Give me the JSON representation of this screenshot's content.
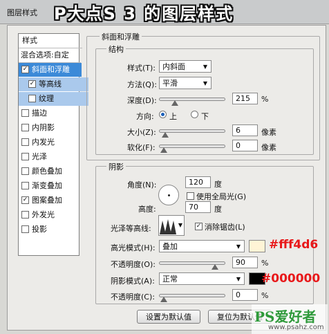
{
  "window": {
    "title": "图层样式",
    "banner": "P大点S 3 的图层样式"
  },
  "sidebar": {
    "header": "样式",
    "blend_options": "混合选项:自定",
    "items": [
      {
        "label": "斜面和浮雕",
        "checked": true
      },
      {
        "label": "等高线",
        "checked": true
      },
      {
        "label": "纹理",
        "checked": false
      },
      {
        "label": "描边",
        "checked": false
      },
      {
        "label": "内阴影",
        "checked": false
      },
      {
        "label": "内发光",
        "checked": false
      },
      {
        "label": "光泽",
        "checked": false
      },
      {
        "label": "颜色叠加",
        "checked": false
      },
      {
        "label": "渐变叠加",
        "checked": false
      },
      {
        "label": "图案叠加",
        "checked": true
      },
      {
        "label": "外发光",
        "checked": false
      },
      {
        "label": "投影",
        "checked": false
      }
    ]
  },
  "bevel": {
    "title": "斜面和浮雕",
    "structure": {
      "title": "结构",
      "style_label": "样式(T):",
      "style_value": "内斜面",
      "technique_label": "方法(Q):",
      "technique_value": "平滑",
      "depth_label": "深度(D):",
      "depth_value": "215",
      "depth_unit": "%",
      "depth_level": 0.2,
      "direction_label": "方向:",
      "direction_up": "上",
      "direction_down": "下",
      "direction_selected": "上",
      "size_label": "大小(Z):",
      "size_value": "6",
      "size_unit": "像素",
      "size_level": 0.03,
      "soften_label": "软化(F):",
      "soften_value": "0",
      "soften_unit": "像素",
      "soften_level": 0
    },
    "shading": {
      "title": "阴影",
      "angle_label": "角度(N):",
      "angle_value": "120",
      "angle_unit": "度",
      "global_light_label": "使用全局光(G)",
      "global_light_checked": false,
      "altitude_label": "高度:",
      "altitude_value": "70",
      "altitude_unit": "度",
      "gloss_contour_label": "光泽等高线:",
      "antialias_label": "消除锯齿(L)",
      "antialias_checked": true,
      "highlight_mode_label": "高光模式(H):",
      "highlight_mode_value": "叠加",
      "highlight_color": "#fff4d6",
      "highlight_opacity_label": "不透明度(O):",
      "highlight_opacity_value": "90",
      "highlight_opacity_unit": "%",
      "highlight_opacity_level": 0.9,
      "shadow_mode_label": "阴影模式(A):",
      "shadow_mode_value": "正常",
      "shadow_color": "#000000",
      "shadow_opacity_label": "不透明度(C):",
      "shadow_opacity_value": "0",
      "shadow_opacity_unit": "%",
      "shadow_opacity_level": 0
    }
  },
  "buttons": {
    "make_default": "设置为默认值",
    "reset_default": "复位为默认值"
  },
  "annotations": {
    "highlight_hex": "#fff4d6",
    "shadow_hex": "#000000"
  },
  "watermark": {
    "brand": "PS爱好者",
    "url": "www.psahz.com"
  }
}
